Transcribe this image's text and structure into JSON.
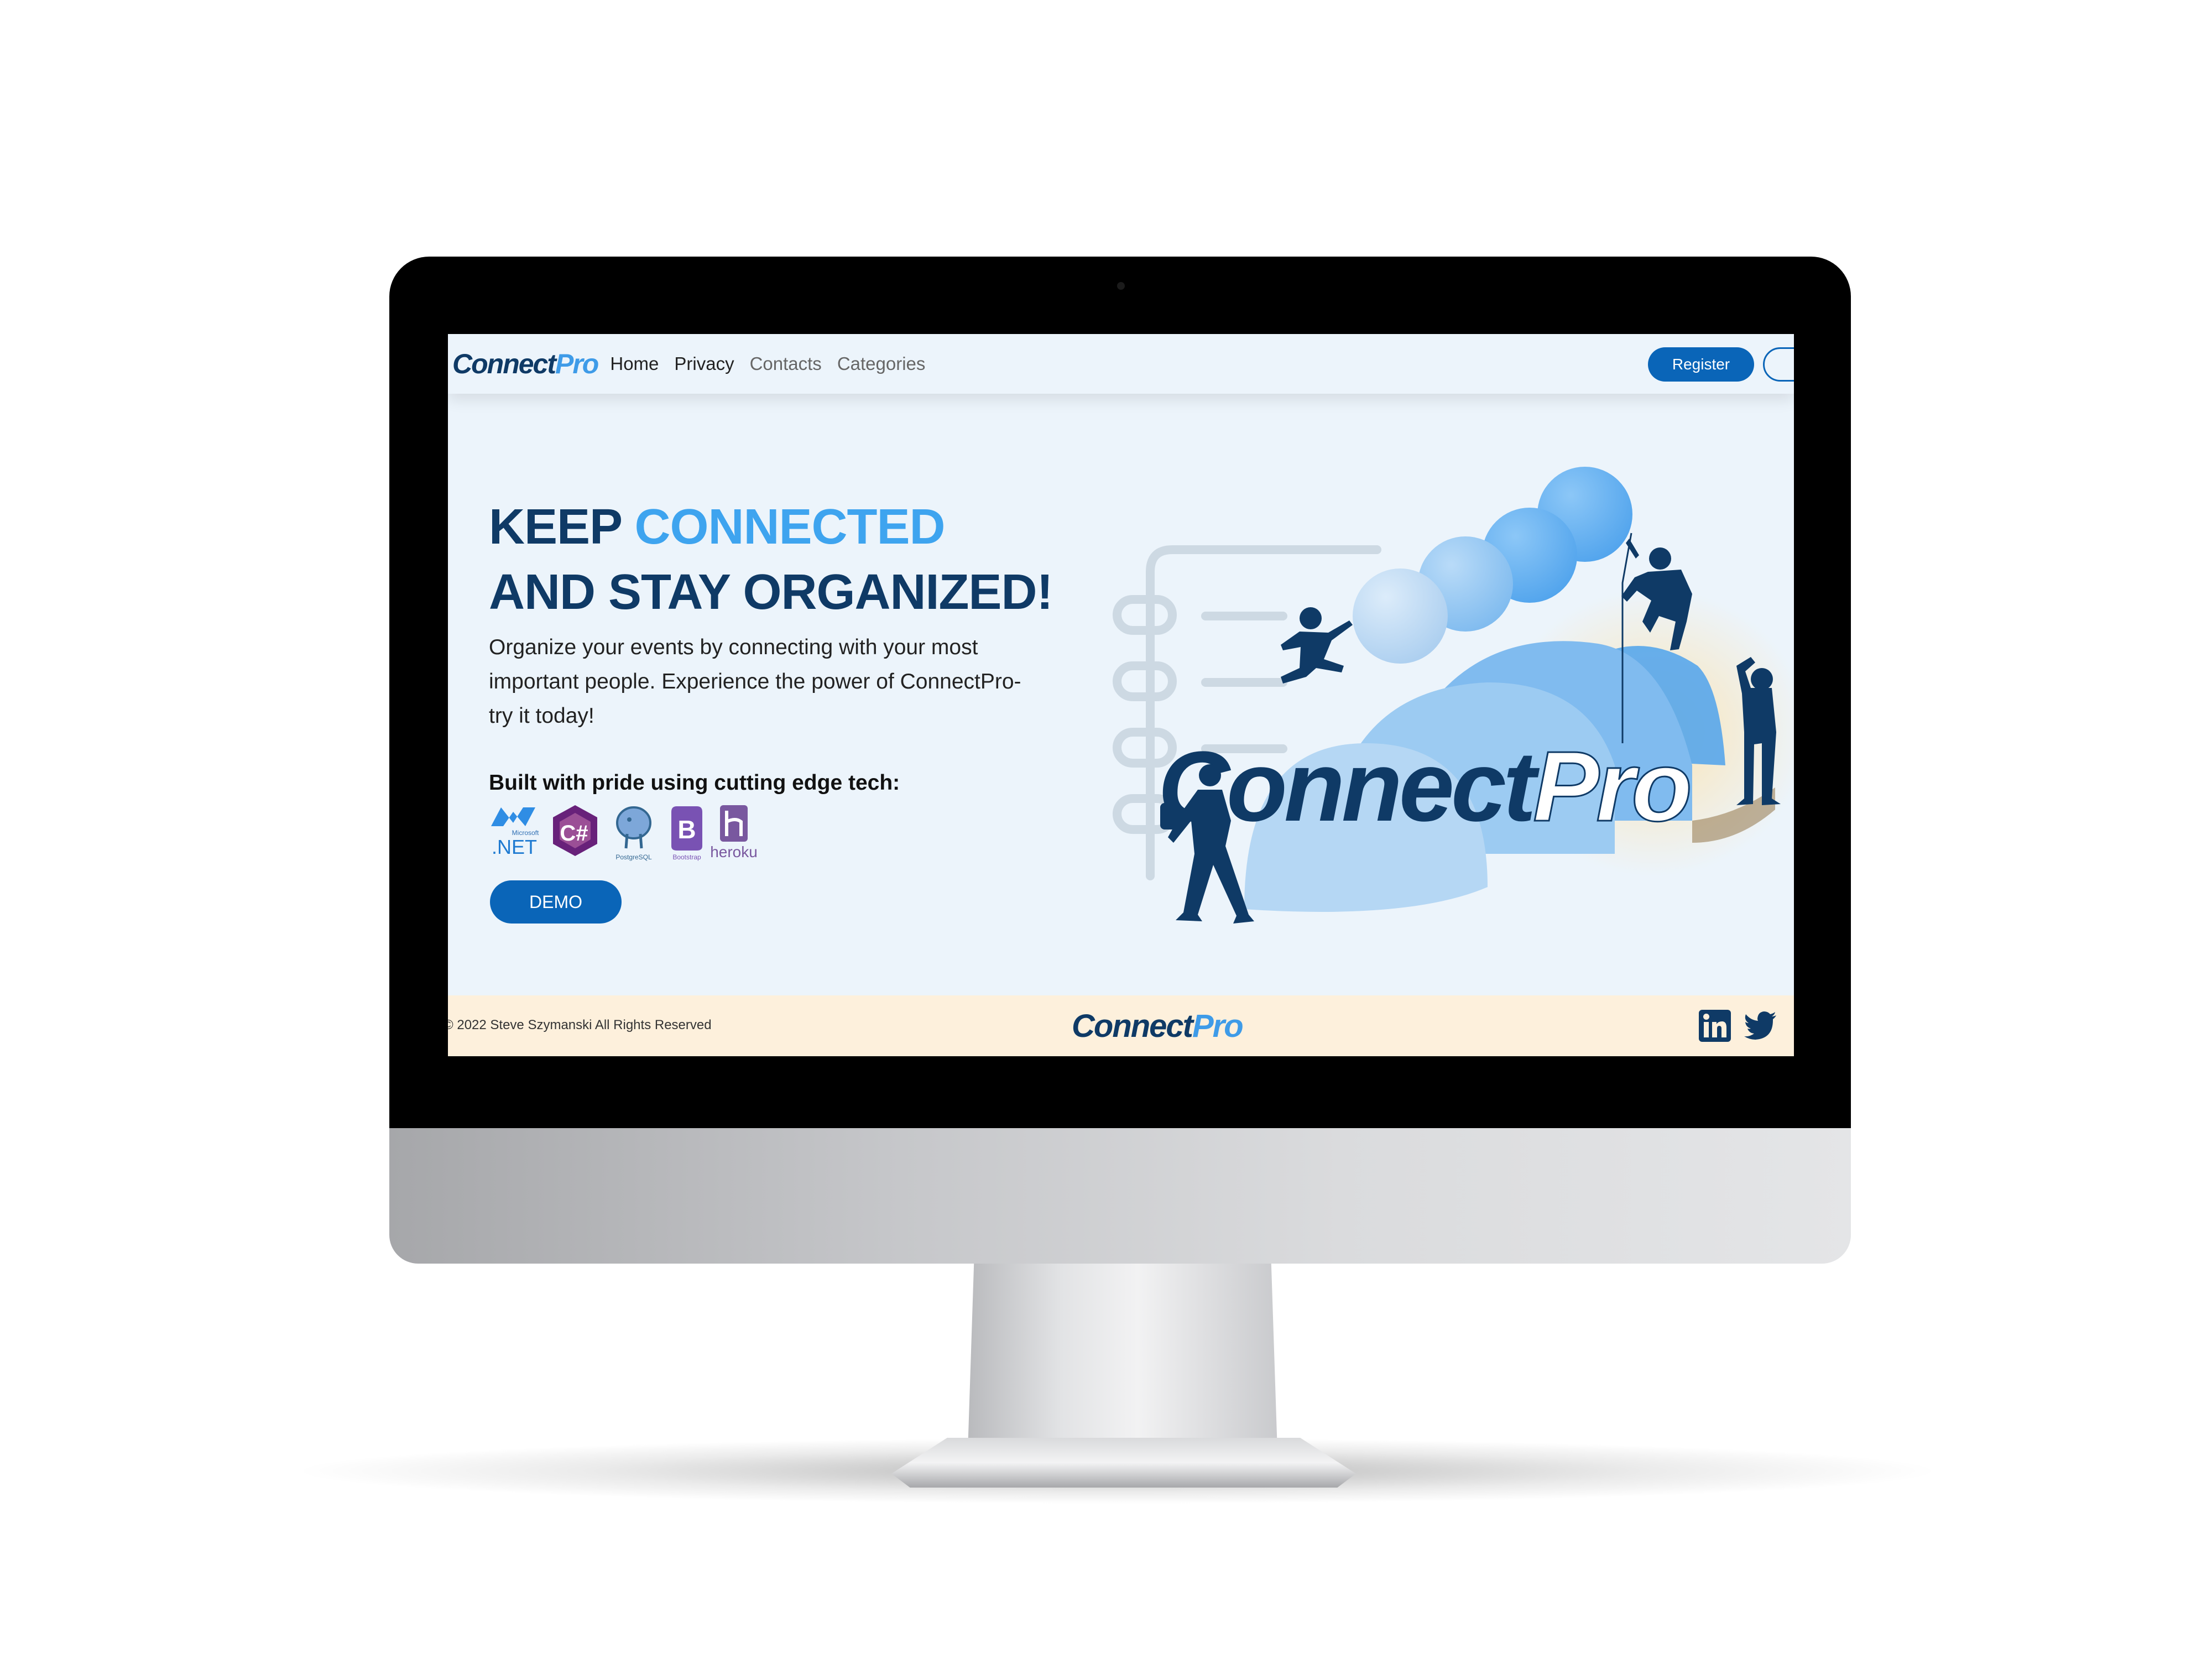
{
  "nav": {
    "logo_main": "Connect",
    "logo_accent": "Pro",
    "links": [
      "Home",
      "Privacy",
      "Contacts",
      "Categories"
    ],
    "register_label": "Register"
  },
  "hero": {
    "title_line1_prefix": "KEEP ",
    "title_line1_highlight": "CONNECTED",
    "title_line2": "AND STAY ORGANIZED!",
    "description": "Organize your events by connecting with your most important people. Experience the power of ConnectPro- try it today!",
    "tech_title": "Built with pride using cutting edge tech:",
    "tech_icons": [
      {
        "name": "dotnet-icon",
        "label": ".NET",
        "sub": "Microsoft"
      },
      {
        "name": "csharp-icon",
        "label": "C#"
      },
      {
        "name": "postgresql-icon",
        "label": "PostgreSQL"
      },
      {
        "name": "bootstrap-icon",
        "label": "B",
        "sub": "Bootstrap"
      },
      {
        "name": "heroku-icon",
        "label": "heroku"
      }
    ],
    "demo_label": "DEMO"
  },
  "illustration": {
    "logo_main": "Connect",
    "logo_accent": "Pro"
  },
  "footer": {
    "copyright": "© 2022 Steve Szymanski All Rights Reserved",
    "logo_main": "Connect",
    "logo_accent": "Pro",
    "social": [
      "linkedin-icon",
      "twitter-icon"
    ]
  },
  "colors": {
    "navy": "#0f3a66",
    "accent": "#3ea4ef",
    "button": "#0a65b8",
    "page_bg": "#ecf4fb",
    "footer_bg": "#fdf0dc"
  }
}
